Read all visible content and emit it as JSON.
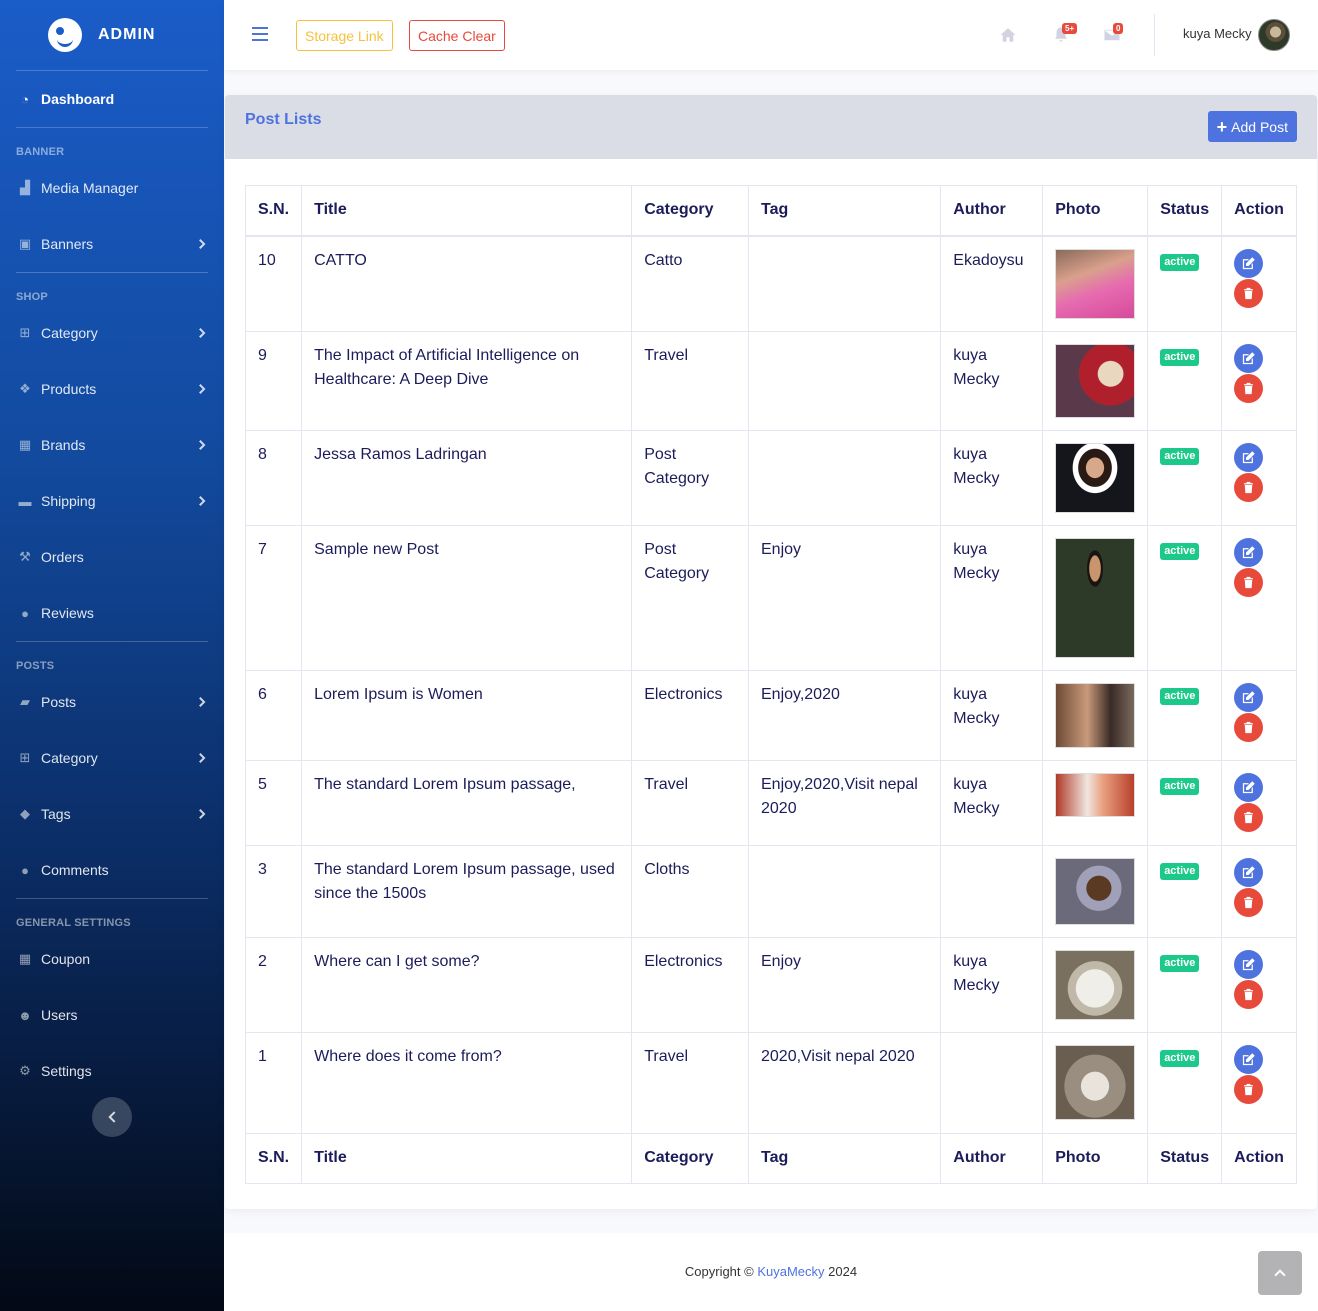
{
  "sidebar": {
    "brand": "ADMIN",
    "dashboard": "Dashboard",
    "headings": {
      "banner": "BANNER",
      "shop": "SHOP",
      "posts": "POSTS",
      "general": "GENERAL SETTINGS"
    },
    "items": {
      "media_manager": "Media Manager",
      "banners": "Banners",
      "category": "Category",
      "products": "Products",
      "brands": "Brands",
      "shipping": "Shipping",
      "orders": "Orders",
      "reviews": "Reviews",
      "posts": "Posts",
      "post_category": "Category",
      "tags": "Tags",
      "comments": "Comments",
      "coupon": "Coupon",
      "users": "Users",
      "settings": "Settings"
    }
  },
  "topbar": {
    "storage_link": "Storage Link",
    "cache_clear": "Cache Clear",
    "alerts_count": "5+",
    "messages_count": "0",
    "user_name": "kuya Mecky"
  },
  "card": {
    "title": "Post Lists",
    "add_button": "Add Post"
  },
  "table": {
    "headers": [
      "S.N.",
      "Title",
      "Category",
      "Tag",
      "Author",
      "Photo",
      "Status",
      "Action"
    ],
    "rows": [
      {
        "sn": "10",
        "title": "CATTO",
        "category": "Catto",
        "tag": "",
        "author": "Ekadoysu",
        "status": "active",
        "photo": "pink-dress"
      },
      {
        "sn": "9",
        "title": "The Impact of Artificial Intelligence on Healthcare: A Deep Dive",
        "category": "Travel",
        "tag": "",
        "author": "kuya Mecky",
        "status": "active",
        "photo": "mascot"
      },
      {
        "sn": "8",
        "title": "Jessa Ramos Ladringan",
        "category": "Post Category",
        "tag": "",
        "author": "kuya Mecky",
        "status": "active",
        "photo": "portrait-woman"
      },
      {
        "sn": "7",
        "title": "Sample new Post",
        "category": "Post Category",
        "tag": "Enjoy",
        "author": "kuya Mecky",
        "status": "active",
        "photo": "graduate"
      },
      {
        "sn": "6",
        "title": "Lorem Ipsum is Women",
        "category": "Electronics",
        "tag": "Enjoy,2020",
        "author": "kuya Mecky",
        "status": "active",
        "photo": "cartoon-man"
      },
      {
        "sn": "5",
        "title": "The standard Lorem Ipsum passage,",
        "category": "Travel",
        "tag": "Enjoy,2020,Visit nepal 2020",
        "author": "kuya Mecky",
        "status": "active",
        "photo": "kitten"
      },
      {
        "sn": "3",
        "title": "The standard Lorem Ipsum passage, used since the 1500s",
        "category": "Cloths",
        "tag": "",
        "author": "",
        "status": "active",
        "photo": "smiling-kid"
      },
      {
        "sn": "2",
        "title": "Where can I get some?",
        "category": "Electronics",
        "tag": "Enjoy",
        "author": "kuya Mecky",
        "status": "active",
        "photo": "white-cat"
      },
      {
        "sn": "1",
        "title": "Where does it come from?",
        "category": "Travel",
        "tag": "2020,Visit nepal 2020",
        "author": "",
        "status": "active",
        "photo": "grumpy-cat"
      }
    ]
  },
  "footer": {
    "prefix": "Copyright ©",
    "brand": "KuyaMecky",
    "year": "2024"
  }
}
